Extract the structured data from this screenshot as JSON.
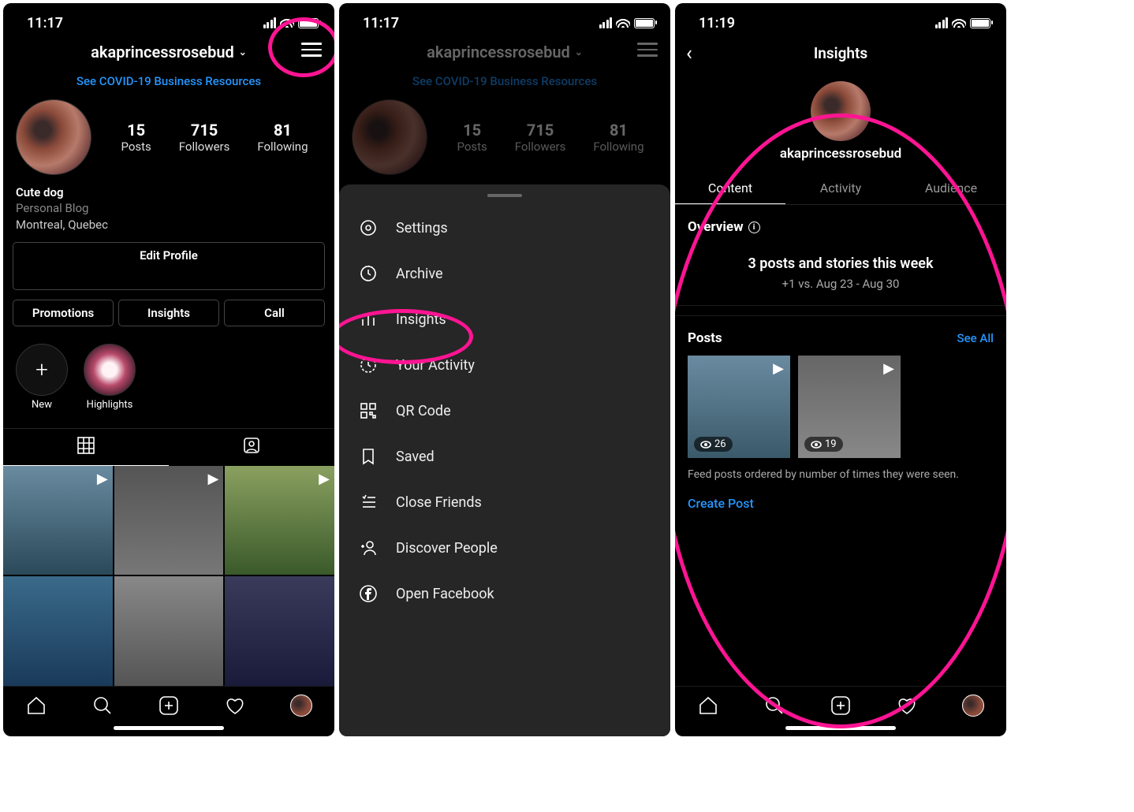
{
  "screen1": {
    "time": "11:17",
    "username": "akaprincessrosebud",
    "covid_link": "See COVID-19 Business Resources",
    "stats": {
      "posts": {
        "num": "15",
        "label": "Posts"
      },
      "followers": {
        "num": "715",
        "label": "Followers"
      },
      "following": {
        "num": "81",
        "label": "Following"
      }
    },
    "bio": {
      "name": "Cute dog",
      "category": "Personal Blog",
      "location": "Montreal, Quebec"
    },
    "buttons": {
      "edit": "Edit Profile",
      "promotions": "Promotions",
      "insights": "Insights",
      "call": "Call"
    },
    "highlights": {
      "new": "New",
      "highlights": "Highlights"
    }
  },
  "screen2": {
    "time": "11:17",
    "username": "akaprincessrosebud",
    "covid_link": "See COVID-19 Business Resources",
    "stats": {
      "posts": {
        "num": "15",
        "label": "Posts"
      },
      "followers": {
        "num": "715",
        "label": "Followers"
      },
      "following": {
        "num": "81",
        "label": "Following"
      }
    },
    "menu": {
      "settings": "Settings",
      "archive": "Archive",
      "insights": "Insights",
      "activity": "Your Activity",
      "qr": "QR Code",
      "saved": "Saved",
      "close_friends": "Close Friends",
      "discover": "Discover People",
      "facebook": "Open Facebook"
    }
  },
  "screen3": {
    "time": "11:19",
    "title": "Insights",
    "username": "akaprincessrosebud",
    "tabs": {
      "content": "Content",
      "activity": "Activity",
      "audience": "Audience"
    },
    "overview": {
      "label": "Overview",
      "main": "3 posts and stories this week",
      "sub": "+1 vs. Aug 23 - Aug 30"
    },
    "posts": {
      "label": "Posts",
      "see_all": "See All",
      "items": [
        {
          "views": "26"
        },
        {
          "views": "19"
        }
      ],
      "caption": "Feed posts ordered by number of times they were seen.",
      "create": "Create Post"
    }
  }
}
